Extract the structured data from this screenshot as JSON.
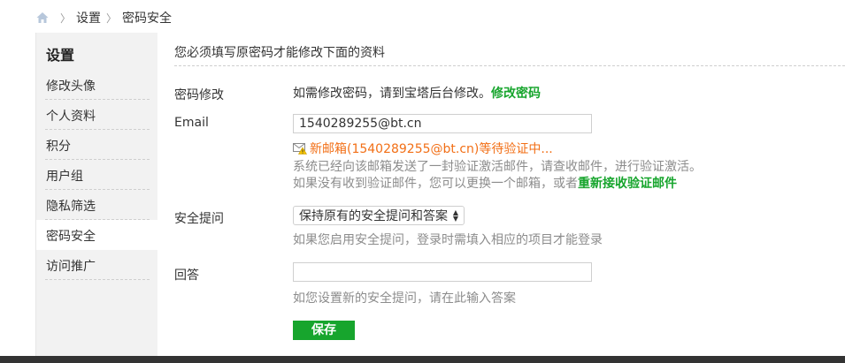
{
  "breadcrumb": {
    "home_icon": "home-icon",
    "items": [
      "设置",
      "密码安全"
    ]
  },
  "sidebar": {
    "title": "设置",
    "items": [
      {
        "label": "修改头像"
      },
      {
        "label": "个人资料"
      },
      {
        "label": "积分"
      },
      {
        "label": "用户组"
      },
      {
        "label": "隐私筛选"
      },
      {
        "label": "密码安全"
      },
      {
        "label": "访问推广"
      }
    ],
    "active_label": "密码安全"
  },
  "main": {
    "notice": "您必须填写原密码才能修改下面的资料",
    "password": {
      "label": "密码修改",
      "text": "如需修改密码，请到宝塔后台修改。",
      "link": "修改密码"
    },
    "email": {
      "label": "Email",
      "value": "1540289255@bt.cn",
      "pending": "新邮箱(1540289255@bt.cn)等待验证中...",
      "sent_note": "系统已经向该邮箱发送了一封验证激活邮件，请查收邮件，进行验证激活。",
      "resend_prefix": "如果没有收到验证邮件，您可以更换一个邮箱，或者",
      "resend_link": "重新接收验证邮件"
    },
    "security_question": {
      "label": "安全提问",
      "selected": "保持原有的安全提问和答案",
      "hint": "如果您启用安全提问，登录时需填入相应的项目才能登录"
    },
    "answer": {
      "label": "回答",
      "value": "",
      "hint": "如您设置新的安全提问，请在此输入答案"
    },
    "save_label": "保存"
  },
  "colors": {
    "accent_green": "#17a52d",
    "warning_orange": "#f26f16",
    "sidebar_bg": "#f2f2f2"
  }
}
